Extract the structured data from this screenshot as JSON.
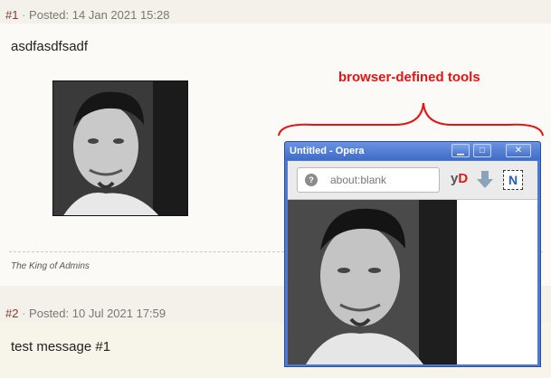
{
  "posts": [
    {
      "number": "#1",
      "posted_label": "Posted:",
      "posted_date": "14 Jan 2021 15:28",
      "message": "asdfasdfsadf",
      "signature": "The King of Admins"
    },
    {
      "number": "#2",
      "posted_label": "Posted:",
      "posted_date": "10 Jul 2021 17:59",
      "message": "test message #1"
    }
  ],
  "annotation": {
    "text": "browser-defined tools",
    "color": "#e31414"
  },
  "opera": {
    "title": "Untitled - Opera",
    "address": "about:blank",
    "tools": {
      "yd_y": "y",
      "yd_d": "D",
      "n_label": "N"
    },
    "icons": [
      "minimize-icon",
      "maximize-icon",
      "close-icon",
      "site-info-icon",
      "download-arrow-icon"
    ]
  },
  "colors": {
    "post_number": "#7a3b3b",
    "page_bg": "#f4f1ea",
    "window_blue": "#4d7ad0"
  }
}
